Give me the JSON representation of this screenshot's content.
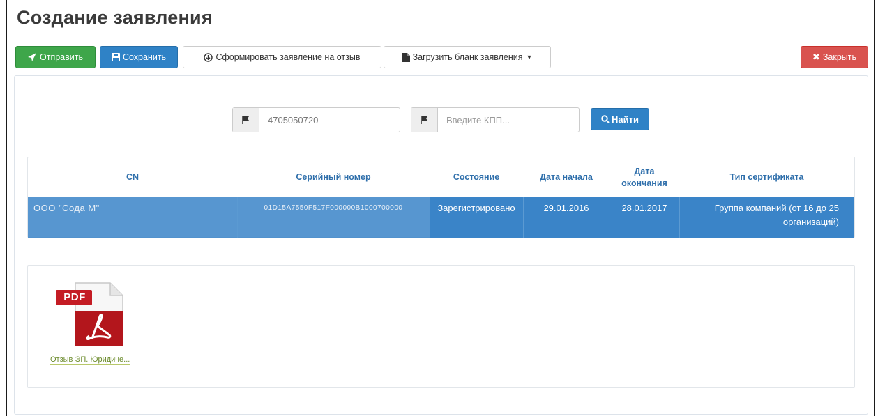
{
  "page": {
    "title": "Создание заявления"
  },
  "toolbar": {
    "send_label": "Отправить",
    "save_label": "Сохранить",
    "form_label": "Сформировать заявление на отзыв",
    "load_label": "Загрузить бланк заявления",
    "close_label": "Закрыть"
  },
  "search": {
    "inn_value": "4705050720",
    "kpp_placeholder": "Введите КПП...",
    "find_label": "Найти"
  },
  "table": {
    "headers": [
      "CN",
      "Серийный номер",
      "Состояние",
      "Дата начала",
      "Дата окончания",
      "Тип сертификата"
    ],
    "rows": [
      {
        "cn": "ООО \"Сода М\"",
        "serial": "01D15A7550F517F000000B1000700000",
        "state": "Зарегистрировано",
        "start": "29.01.2016",
        "end": "28.01.2017",
        "type": "Группа компаний (от 16 до 25 организаций)"
      }
    ]
  },
  "files": [
    {
      "badge": "PDF",
      "caption": "Отзыв ЭП. Юридиче..."
    }
  ],
  "colors": {
    "send": "#3ea64a",
    "save": "#2f82c6",
    "close": "#d9534f",
    "selected_row": "#3a84c8",
    "header_text": "#2f6fab"
  }
}
